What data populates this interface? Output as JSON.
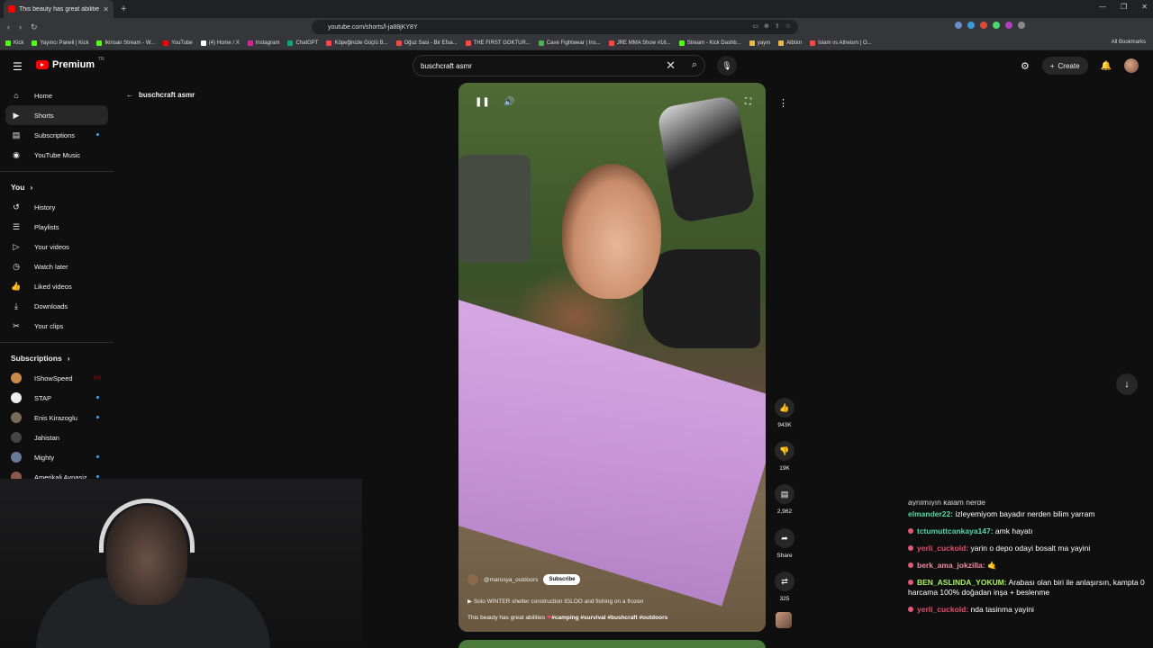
{
  "browser": {
    "tab_title": "This beauty has great abilitie",
    "url": "youtube.com/shorts/l-ja88jKY8Y",
    "bookmarks": [
      "Kick",
      "Yayıncı Paneli | Kick",
      "Ikinsan Stream - W...",
      "YouTube",
      "(4) Home / X",
      "Instagram",
      "ChatGPT",
      "Köpeğinizle Güçlü B...",
      "Oğuz Sasi - Bir Efsa...",
      "THE FIRST GOKTUR...",
      "Cave Fightwear | Ins...",
      "JRE MMA Show #16...",
      "Stream - Kick Dashb...",
      "yayın",
      "Albüm",
      "Islam vs Atheism | O..."
    ],
    "all_bookmarks": "All Bookmarks"
  },
  "header": {
    "logo_text": "Premium",
    "logo_sup": "TR",
    "search_value": "buschcraft asmr",
    "create_label": "Create"
  },
  "sidebar": {
    "main": [
      {
        "label": "Home",
        "icon": "home-icon",
        "glyph": "⌂"
      },
      {
        "label": "Shorts",
        "icon": "shorts-icon",
        "glyph": "▶"
      },
      {
        "label": "Subscriptions",
        "icon": "subscriptions-icon",
        "glyph": "▤"
      },
      {
        "label": "YouTube Music",
        "icon": "music-icon",
        "glyph": "◉"
      }
    ],
    "you_label": "You",
    "you": [
      {
        "label": "History",
        "icon": "history-icon",
        "glyph": "↺"
      },
      {
        "label": "Playlists",
        "icon": "playlists-icon",
        "glyph": "☰"
      },
      {
        "label": "Your videos",
        "icon": "your-videos-icon",
        "glyph": "▷"
      },
      {
        "label": "Watch later",
        "icon": "watch-later-icon",
        "glyph": "◷"
      },
      {
        "label": "Liked videos",
        "icon": "liked-icon",
        "glyph": "👍"
      },
      {
        "label": "Downloads",
        "icon": "downloads-icon",
        "glyph": "⤓"
      },
      {
        "label": "Your clips",
        "icon": "clips-icon",
        "glyph": "✂"
      }
    ],
    "subs_label": "Subscriptions",
    "subs": [
      {
        "label": "IShowSpeed",
        "color": "#c98a4a",
        "live": true
      },
      {
        "label": "STAP",
        "color": "#eeeeee",
        "live": false
      },
      {
        "label": "Enis Kirazoglu",
        "color": "#7a6a5a",
        "live": false
      },
      {
        "label": "Jahistan",
        "color": "#444444",
        "live": false
      },
      {
        "label": "Mighty",
        "color": "#6a7a9a",
        "live": false
      },
      {
        "label": "Amerikali Avnasiz",
        "color": "#8a5a4a",
        "live": false
      }
    ]
  },
  "shorts_back_label": "buschcraft asmr",
  "video": {
    "channel": "@marusya_outdoors",
    "subscribe_label": "Subscribe",
    "related": "Solo WINTER shelter construction IGLOO and fishing on a frozen",
    "title_plain": "This beauty has great abilities ",
    "title_tags": "#camping #survival #bushcraft #outdoors"
  },
  "actions": {
    "likes": "943K",
    "dislikes": "19K",
    "comments": "2,962",
    "share": "Share",
    "remix": "325"
  },
  "chat": {
    "partial_top": "ayrılmıyın kalam nerde",
    "messages": [
      {
        "user": "elmander22:",
        "text": " izleyemiyom bayadır nerden bilim yarram",
        "color": "#53d8a8",
        "badge": false
      },
      {
        "user": "tctumuttcankaya147:",
        "text": " amk hayatı",
        "color": "#53d8a8",
        "badge": true
      },
      {
        "user": "yerli_cuckold:",
        "text": " yarin o depo odayi bosalt ma yayini",
        "color": "#e0506a",
        "badge": true
      },
      {
        "user": "berk_ama_jokzilla:",
        "text": " 🤙",
        "color": "#f08aa8",
        "badge": true
      },
      {
        "user": "BEN_ASLINDA_YOKUM:",
        "text": " Arabası olan biri ile anlaşırsın, kampta 0 harcama 100% doğadan inşa + beslenme",
        "color": "#a8f060",
        "badge": true
      },
      {
        "user": "yerli_cuckold:",
        "text": " nda tasinma yayini",
        "color": "#e0506a",
        "badge": true
      }
    ]
  }
}
